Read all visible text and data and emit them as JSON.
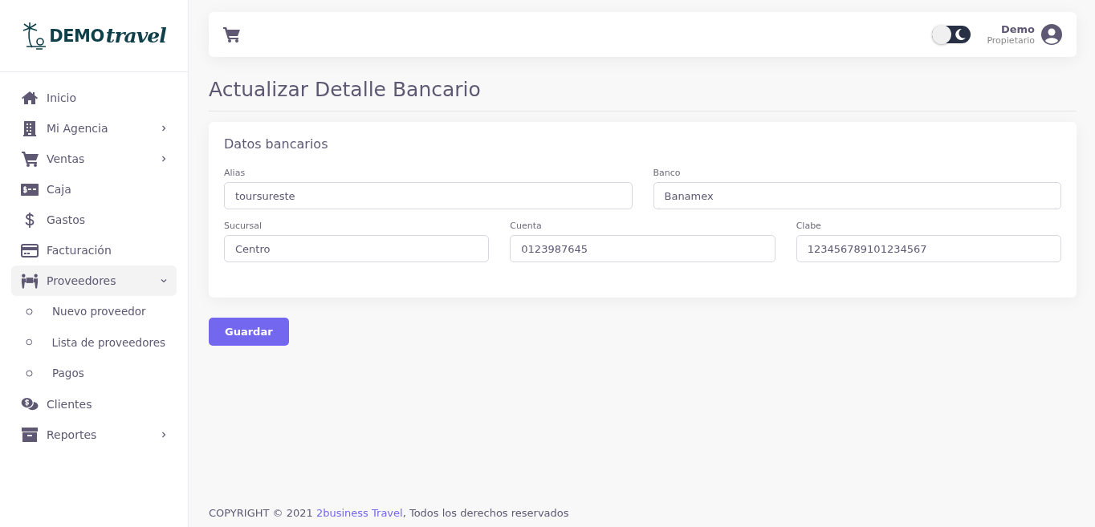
{
  "logo": {
    "word": "DEMO",
    "script": "travel"
  },
  "sidebar": {
    "items": [
      {
        "label": "Inicio"
      },
      {
        "label": "Mi Agencia",
        "expanded": false
      },
      {
        "label": "Ventas",
        "expanded": false
      },
      {
        "label": "Caja"
      },
      {
        "label": "Gastos"
      },
      {
        "label": "Facturación"
      },
      {
        "label": "Proveedores",
        "expanded": true,
        "children": [
          {
            "label": "Nuevo proveedor"
          },
          {
            "label": "Lista de proveedores"
          },
          {
            "label": "Pagos"
          }
        ]
      },
      {
        "label": "Clientes"
      },
      {
        "label": "Reportes",
        "expanded": false
      }
    ]
  },
  "topbar": {
    "dark_mode": {
      "on": false
    },
    "user": {
      "name": "Demo",
      "role": "Propietario"
    }
  },
  "page_title": "Actualizar Detalle Bancario",
  "card": {
    "title": "Datos bancarios",
    "rows": [
      [
        {
          "label": "Alias",
          "value": "toursureste"
        },
        {
          "label": "Banco",
          "value": "Banamex"
        }
      ],
      [
        {
          "label": "Sucursal",
          "value": "Centro"
        },
        {
          "label": "Cuenta",
          "value": "0123987645"
        },
        {
          "label": "Clabe",
          "value": "123456789101234567"
        }
      ]
    ]
  },
  "save_button": "Guardar",
  "footer": {
    "prefix": "COPYRIGHT © 2021 ",
    "link": "2business Travel",
    "suffix": ", Todos los derechos reservados"
  }
}
